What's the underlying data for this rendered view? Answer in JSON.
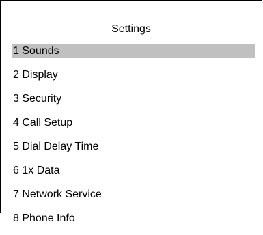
{
  "title": "Settings",
  "selected_index": 0,
  "colors": {
    "highlight": "#c0c0c0",
    "border": "#000000",
    "background": "#ffffff"
  },
  "menu": [
    {
      "label": "1 Sounds"
    },
    {
      "label": "2 Display"
    },
    {
      "label": "3 Security"
    },
    {
      "label": "4 Call Setup"
    },
    {
      "label": "5 Dial Delay Time"
    },
    {
      "label": "6 1x Data"
    },
    {
      "label": "7 Network Service"
    },
    {
      "label": "8 Phone Info"
    }
  ]
}
